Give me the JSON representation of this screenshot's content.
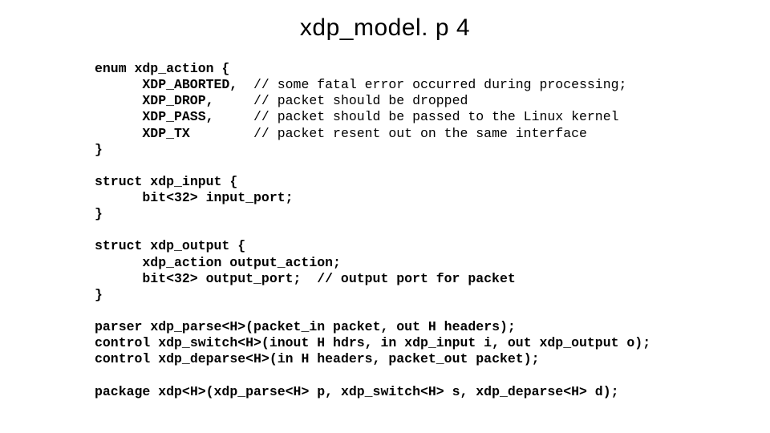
{
  "title": "xdp_model. p 4",
  "enum": {
    "decl": "enum xdp_action {",
    "items": [
      {
        "name": "XDP_ABORTED,",
        "comment": "// some fatal error occurred during processing;"
      },
      {
        "name": "XDP_DROP,",
        "comment": "// packet should be dropped"
      },
      {
        "name": "XDP_PASS,",
        "comment": "// packet should be passed to the Linux kernel"
      },
      {
        "name": "XDP_TX",
        "comment": "// packet resent out on the same interface"
      }
    ],
    "close": "}"
  },
  "struct_input": {
    "decl": "struct xdp_input {",
    "field": "bit<32> input_port;",
    "close": "}"
  },
  "struct_output": {
    "decl": "struct xdp_output {",
    "field1": "xdp_action output_action;",
    "field2": "bit<32> output_port;  // output port for packet",
    "close": "}"
  },
  "parser_kw": "parser",
  "parser_rest": " xdp_parse<H>(packet_in packet, out H headers);",
  "control_kw": "control",
  "control1_rest": " xdp_switch<H>(inout H hdrs, in xdp_input i, out xdp_output o);",
  "control2_rest": " xdp_deparse<H>(in H headers, packet_out packet);",
  "package_kw": "package",
  "package_rest": " xdp<H>(xdp_parse<H> p, xdp_switch<H> s, xdp_deparse<H> d);"
}
